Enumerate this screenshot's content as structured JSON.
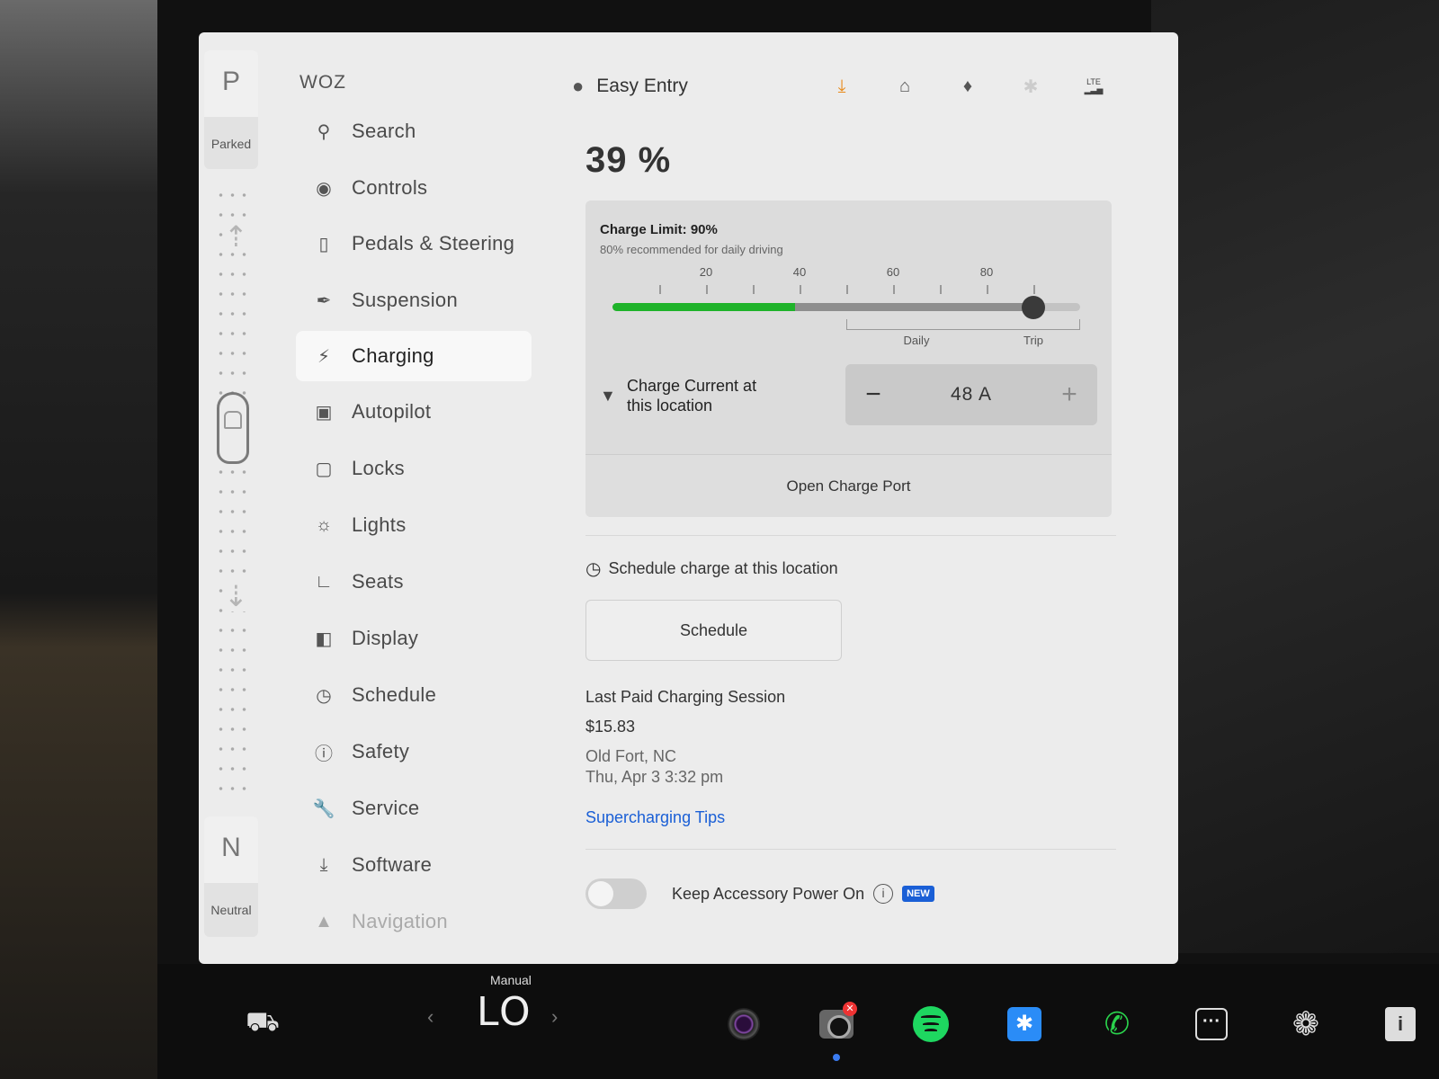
{
  "gear": {
    "park_letter": "P",
    "park_label": "Parked",
    "neutral_letter": "N",
    "neutral_label": "Neutral"
  },
  "car_name": "WOZ",
  "menu": {
    "items": [
      {
        "label": "Search",
        "icon": "search-icon"
      },
      {
        "label": "Controls",
        "icon": "toggle-icon"
      },
      {
        "label": "Pedals & Steering",
        "icon": "car-icon"
      },
      {
        "label": "Suspension",
        "icon": "wrench-icon"
      },
      {
        "label": "Charging",
        "icon": "lightning-icon"
      },
      {
        "label": "Autopilot",
        "icon": "steering-wheel-icon"
      },
      {
        "label": "Locks",
        "icon": "lock-icon"
      },
      {
        "label": "Lights",
        "icon": "sun-icon"
      },
      {
        "label": "Seats",
        "icon": "seat-icon"
      },
      {
        "label": "Display",
        "icon": "display-icon"
      },
      {
        "label": "Schedule",
        "icon": "alarm-icon"
      },
      {
        "label": "Safety",
        "icon": "alert-icon"
      },
      {
        "label": "Service",
        "icon": "wrench-icon"
      },
      {
        "label": "Software",
        "icon": "download-icon"
      },
      {
        "label": "Navigation",
        "icon": "navigation-icon"
      }
    ],
    "active": "Charging"
  },
  "status_bar": {
    "profile_name": "Easy Entry",
    "icons": [
      "download-icon",
      "garage-icon",
      "bell-icon",
      "bluetooth-icon",
      "lte-signal-icon"
    ],
    "lte_label": "LTE",
    "download_color": "#e88a1a"
  },
  "charging": {
    "state_of_charge": "39 %",
    "soc_value": 39,
    "charge_limit_title": "Charge Limit: 90%",
    "charge_limit_value": 90,
    "recommendation": "80% recommended for daily driving",
    "tick_labels": [
      "20",
      "40",
      "60",
      "80"
    ],
    "range_daily": "Daily",
    "range_trip": "Trip",
    "current_label_line1": "Charge Current at",
    "current_label_line2": "this location",
    "current_value": "48 A",
    "minus": "−",
    "plus": "+",
    "open_port": "Open Charge Port",
    "fill_color": "#1fb32a"
  },
  "schedule": {
    "label": "Schedule charge at this location",
    "button": "Schedule"
  },
  "last_session": {
    "title": "Last Paid Charging Session",
    "amount": "$15.83",
    "location": "Old Fort, NC",
    "time": "Thu, Apr 3 3:32 pm"
  },
  "tips_link": "Supercharging Tips",
  "accessory": {
    "label": "Keep Accessory Power On",
    "badge": "NEW",
    "enabled": false
  },
  "dock": {
    "climate_mode": "Manual",
    "climate_temp": "LO",
    "apps": [
      "car-icon",
      "dashcam-icon",
      "camera-icon",
      "spotify-icon",
      "bluetooth-icon",
      "phone-icon",
      "more-icon",
      "fan-icon",
      "info-icon"
    ]
  }
}
